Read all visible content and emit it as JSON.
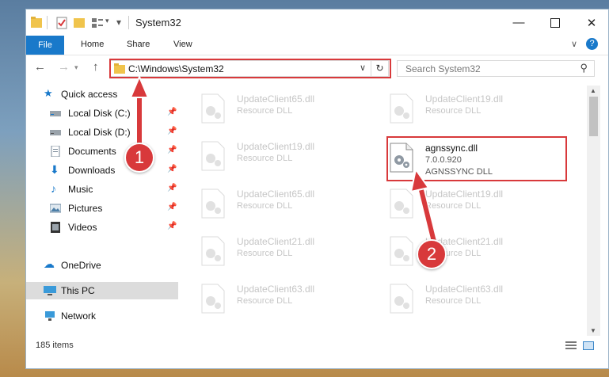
{
  "window": {
    "title": "System32"
  },
  "ribbon": {
    "file": "File",
    "tabs": [
      "Home",
      "Share",
      "View"
    ]
  },
  "nav": {
    "address": "C:\\Windows\\System32",
    "search_placeholder": "Search System32"
  },
  "sidebar": {
    "items": [
      {
        "label": "Quick access",
        "icon": "star-icon",
        "pinned": false
      },
      {
        "label": "Local Disk (C:)",
        "icon": "drive-icon",
        "pinned": true
      },
      {
        "label": "Local Disk (D:)",
        "icon": "drive-icon",
        "pinned": true
      },
      {
        "label": "Documents",
        "icon": "documents-icon",
        "pinned": true
      },
      {
        "label": "Downloads",
        "icon": "download-icon",
        "pinned": true
      },
      {
        "label": "Music",
        "icon": "music-icon",
        "pinned": true
      },
      {
        "label": "Pictures",
        "icon": "pictures-icon",
        "pinned": true
      },
      {
        "label": "Videos",
        "icon": "videos-icon",
        "pinned": true
      },
      {
        "label": "OneDrive",
        "icon": "cloud-icon",
        "pinned": false
      },
      {
        "label": "This PC",
        "icon": "computer-icon",
        "pinned": false,
        "selected": true
      },
      {
        "label": "Network",
        "icon": "network-icon",
        "pinned": false
      }
    ]
  },
  "files": [
    {
      "name": "UpdateClient65.dll",
      "desc": "Resource DLL"
    },
    {
      "name": "UpdateClient19.dll",
      "desc": "Resource DLL"
    },
    {
      "name": "UpdateClient19.dll",
      "desc": "Resource DLL"
    },
    {
      "name": "agnssync.dll",
      "version": "7.0.0.920",
      "desc": "AGNSSYNC DLL"
    },
    {
      "name": "UpdateClient65.dll",
      "desc": "Resource DLL"
    },
    {
      "name": "UpdateClient19.dll",
      "desc": "Resource DLL"
    },
    {
      "name": "UpdateClient21.dll",
      "desc": "Resource DLL"
    },
    {
      "name": "UpdateClient21.dll",
      "desc": "Resource DLL"
    },
    {
      "name": "UpdateClient63.dll",
      "desc": "Resource DLL"
    },
    {
      "name": "UpdateClient63.dll",
      "desc": "Resource DLL"
    }
  ],
  "status": {
    "count": "185 items"
  },
  "annotations": {
    "step1": "1",
    "step2": "2"
  },
  "colors": {
    "accent": "#1979ca",
    "highlight": "#d8393b"
  }
}
